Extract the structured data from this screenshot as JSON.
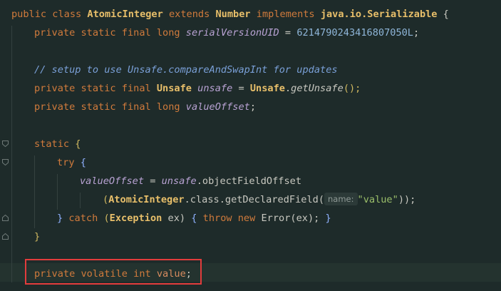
{
  "code": {
    "l1": {
      "t1": "public class ",
      "t2": "AtomicInteger",
      "t3": " extends ",
      "t4": "Number",
      "t5": " implements ",
      "t6": "java.io.Serializable",
      "t7": " {"
    },
    "l2": {
      "t1": "private static final long ",
      "t2": "serialVersionUID",
      "t3": " = ",
      "t4": "6214790243416807050L",
      "t5": ";"
    },
    "l4": {
      "t1": "// setup to use Unsafe.compareAndSwapInt for updates"
    },
    "l5": {
      "t1": "private static final ",
      "t2": "Unsafe",
      "t3": " ",
      "t4": "unsafe",
      "t5": " = ",
      "t6": "Unsafe",
      "t7": ".",
      "t8": "getUnsafe",
      "t9": "();"
    },
    "l6": {
      "t1": "private static final long ",
      "t2": "valueOffset",
      "t3": ";"
    },
    "l8": {
      "t1": "static ",
      "t2": "{"
    },
    "l9": {
      "t1": "try ",
      "t2": "{"
    },
    "l10": {
      "t1": "valueOffset",
      "t2": " = ",
      "t3": "unsafe",
      "t4": ".objectFieldOffset"
    },
    "l11": {
      "t1": "(",
      "t2": "AtomicInteger",
      "t3": ".class.getDeclaredField(",
      "t4": "name:",
      "t5": "\"value\"",
      "t6": "));"
    },
    "l12": {
      "t1": "} ",
      "t2": "catch ",
      "t3": "(",
      "t4": "Exception",
      "t5": " ex) ",
      "t6": "{ ",
      "t7": "throw new ",
      "t8": "Error",
      "t9": "(ex); ",
      "t10": "}"
    },
    "l13": {
      "t1": "}"
    },
    "l15": {
      "t1": "private volatile int ",
      "t2": "value",
      "t3": ";"
    }
  },
  "colors": {
    "background": "#1e2b2a",
    "keyword": "#d17b3c",
    "highlight_box": "#e23c3c"
  }
}
